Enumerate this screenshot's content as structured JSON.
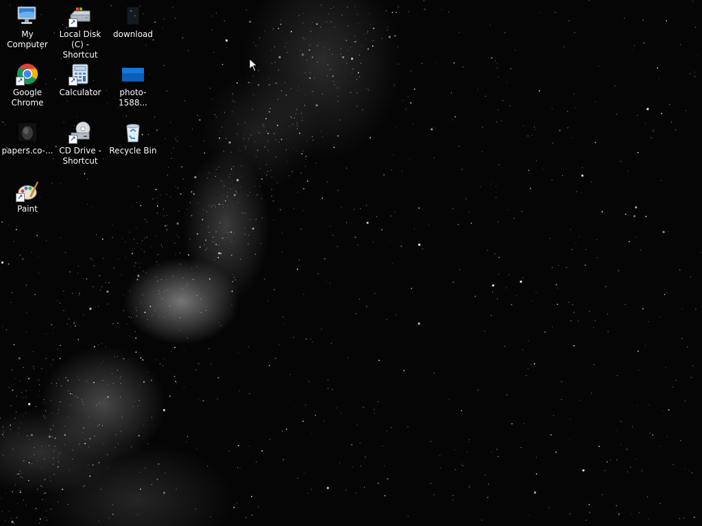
{
  "desktop": {
    "wallpaper": "starry night sky",
    "icons": [
      {
        "label": "My Computer",
        "icon": "computer-icon"
      },
      {
        "label": "Local Disk (C) - Shortcut",
        "icon": "hard-drive-icon"
      },
      {
        "label": "download",
        "icon": "image-file-icon"
      },
      {
        "label": "Google Chrome",
        "icon": "chrome-icon"
      },
      {
        "label": "Calculator",
        "icon": "calculator-icon"
      },
      {
        "label": "photo-1588...",
        "icon": "image-file-icon"
      },
      {
        "label": "papers.co-...",
        "icon": "image-file-icon"
      },
      {
        "label": "CD Drive - Shortcut",
        "icon": "cd-drive-icon"
      },
      {
        "label": "Recycle Bin",
        "icon": "recycle-bin-icon"
      },
      {
        "label": "Paint",
        "icon": "paint-icon"
      }
    ]
  }
}
